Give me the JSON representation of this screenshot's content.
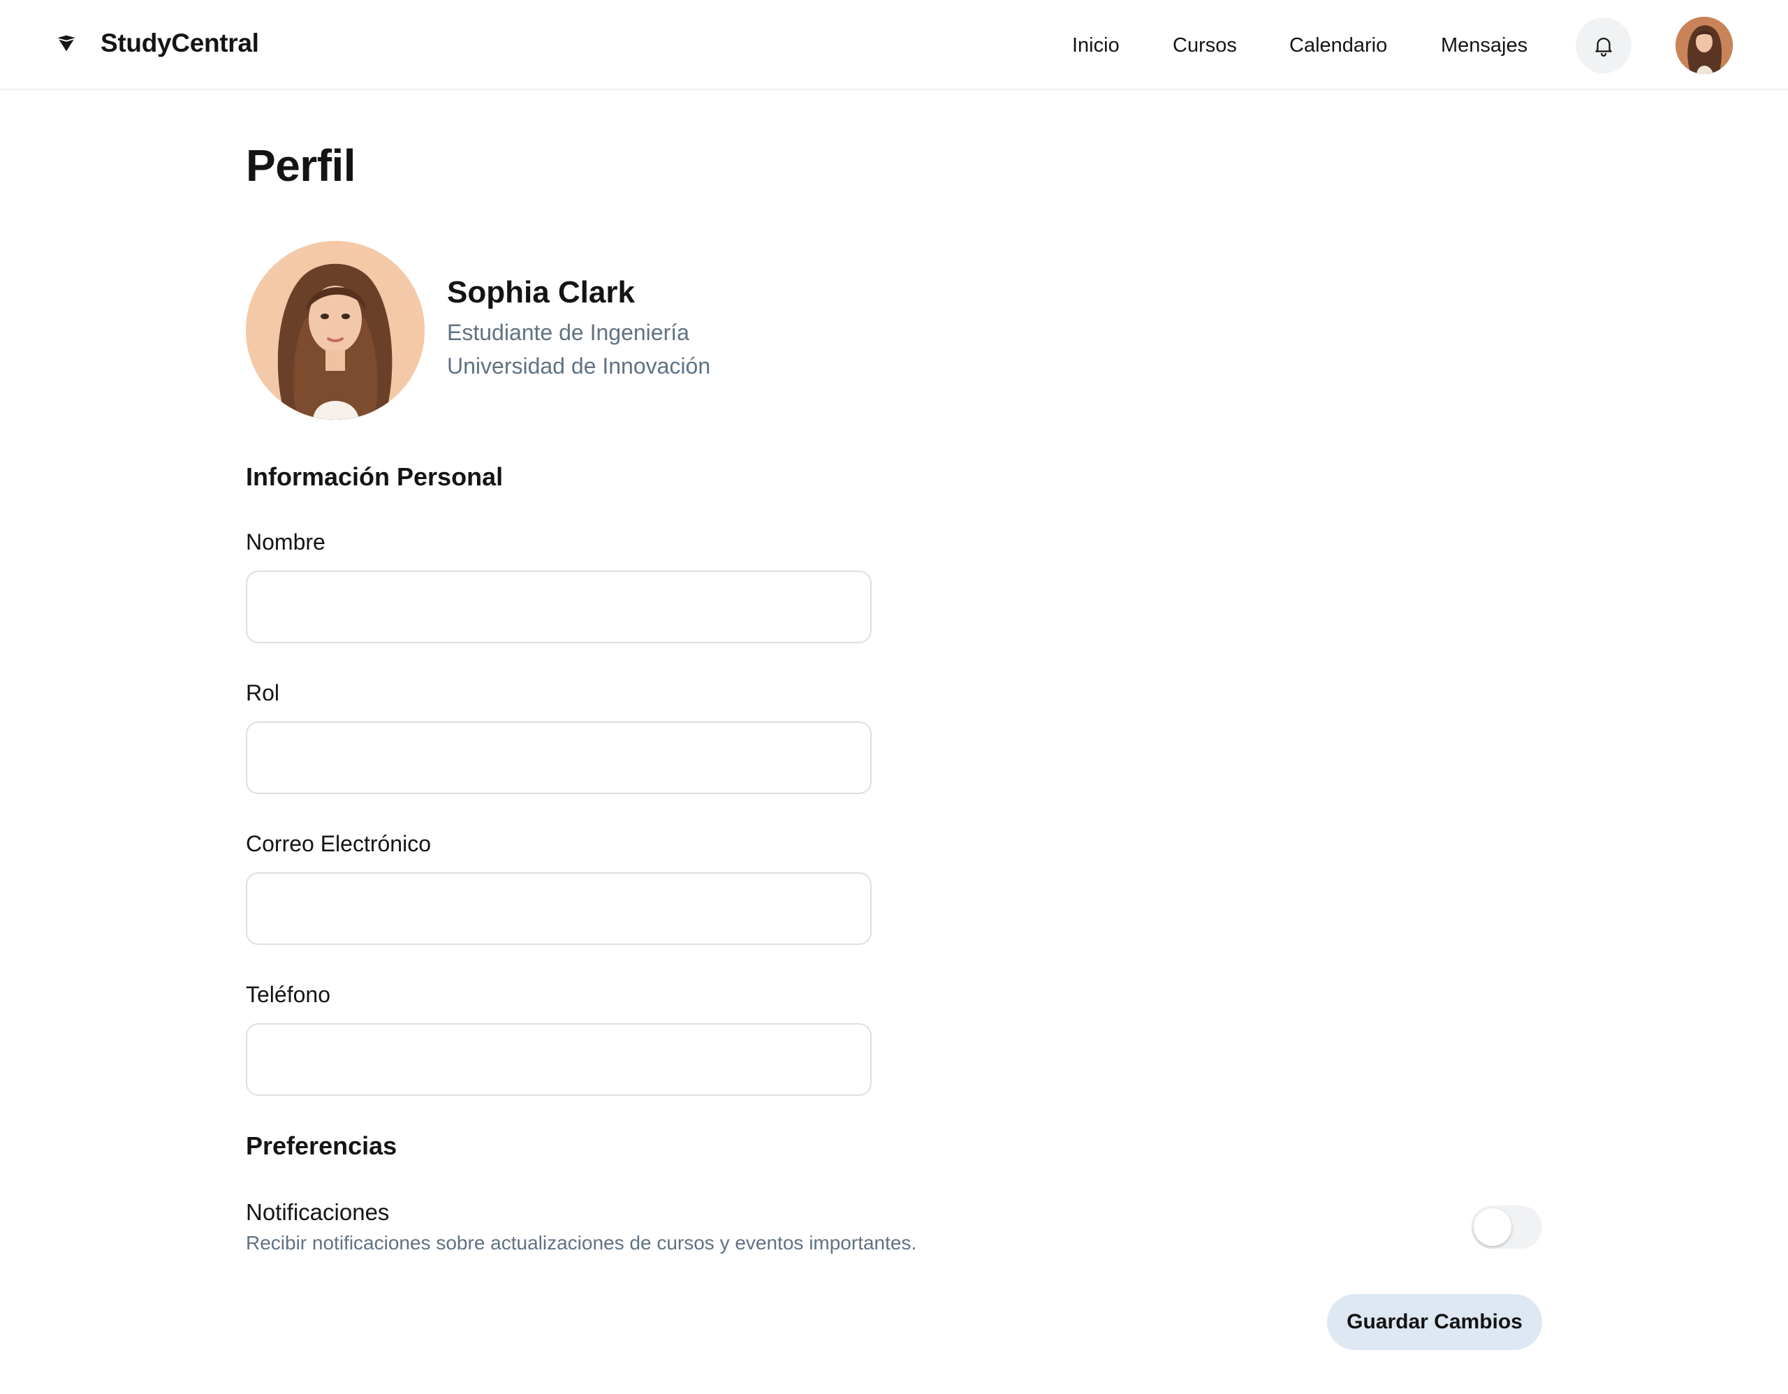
{
  "app": {
    "brand_name": "StudyCentral",
    "brand_icon": "graduation-cap-icon"
  },
  "nav": {
    "items": [
      {
        "label": "Inicio"
      },
      {
        "label": "Cursos"
      },
      {
        "label": "Calendario"
      },
      {
        "label": "Mensajes"
      }
    ],
    "notification_icon": "bell-icon"
  },
  "page": {
    "title": "Perfil"
  },
  "profile": {
    "name": "Sophia Clark",
    "role": "Estudiante de Ingeniería",
    "university": "Universidad de Innovación"
  },
  "personal_info": {
    "section_title": "Información Personal",
    "fields": [
      {
        "label": "Nombre",
        "value": "",
        "placeholder": ""
      },
      {
        "label": "Rol",
        "value": "",
        "placeholder": ""
      },
      {
        "label": "Correo Electrónico",
        "value": "",
        "placeholder": ""
      },
      {
        "label": "Teléfono",
        "value": "",
        "placeholder": ""
      }
    ]
  },
  "preferences": {
    "section_title": "Preferencias",
    "notifications": {
      "title": "Notificaciones",
      "description": "Recibir notificaciones sobre actualizaciones de cursos y eventos importantes.",
      "enabled": false
    }
  },
  "actions": {
    "save_label": "Guardar Cambios"
  },
  "colors": {
    "accent_button_bg": "#dde8f3",
    "muted_text": "#5f7284",
    "toggle_off_bg": "#f0f2f4"
  }
}
